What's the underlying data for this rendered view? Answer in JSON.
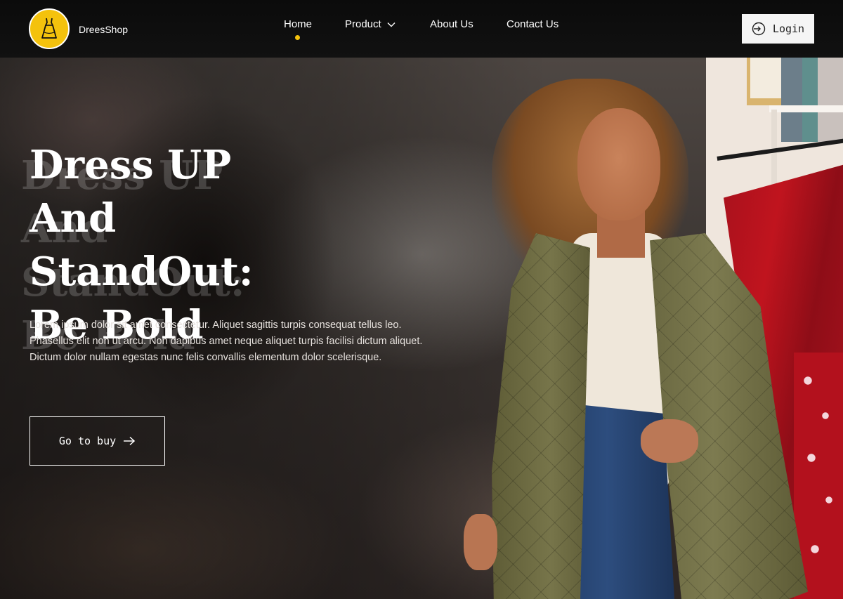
{
  "header": {
    "brand_name": "DreesShop",
    "logo_icon": "dress-icon",
    "accent_color": "#f4c20d",
    "nav": [
      {
        "label": "Home",
        "active": true
      },
      {
        "label": "Product",
        "has_dropdown": true
      },
      {
        "label": "About Us"
      },
      {
        "label": "Contact Us"
      }
    ],
    "login_label": "Login",
    "login_icon": "login-icon"
  },
  "hero": {
    "title": "Dress UP And StandOut: Be Bold",
    "description": "Lorem ipsum dolor sit amet consectetur. Aliquet sagittis turpis consequat tellus leo. Phasellus elit non ut arcu. Non dapibus amet neque aliquet turpis facilisi dictum aliquet. Dictum dolor nullam egestas nunc felis convallis elementum dolor scelerisque.",
    "cta_label": "Go to buy",
    "cta_icon": "arrow-right-icon"
  }
}
